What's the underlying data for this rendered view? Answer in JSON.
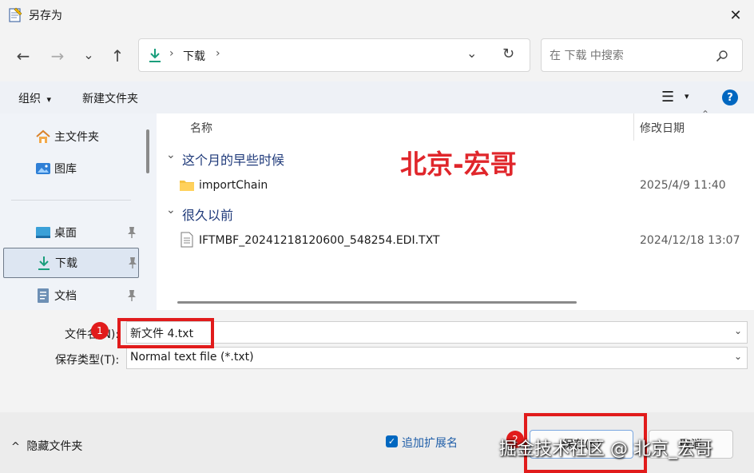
{
  "window": {
    "title": "另存为",
    "close_glyph": "✕"
  },
  "nav": {
    "back_glyph": "←",
    "forward_glyph": "→",
    "recent_glyph": "⌄",
    "up_glyph": "↑",
    "breadcrumb": {
      "sep": "›",
      "current": "下载",
      "sep_end": "›"
    },
    "dropdown_glyph": "⌄",
    "refresh_glyph": "↻"
  },
  "search": {
    "placeholder": "在 下载 中搜索"
  },
  "toolbar": {
    "organize_label": "组织",
    "organize_caret": "▾",
    "new_folder_label": "新建文件夹",
    "view_glyph": "☰",
    "view_caret": "▾",
    "help_glyph": "?"
  },
  "sidebar": {
    "items": [
      {
        "label": "主文件夹",
        "icon": "home-icon"
      },
      {
        "label": "图库",
        "icon": "gallery-icon"
      },
      {
        "label": "桌面",
        "icon": "desktop-icon",
        "pinned": true
      },
      {
        "label": "下载",
        "icon": "download-icon",
        "pinned": true,
        "selected": true
      },
      {
        "label": "文档",
        "icon": "document-icon",
        "pinned": true
      }
    ]
  },
  "file_list": {
    "columns": {
      "name": "名称",
      "modified": "修改日期"
    },
    "groups": [
      {
        "label": "这个月的早些时候",
        "caret": "⌄",
        "rows": [
          {
            "name": "importChain",
            "type": "folder",
            "modified": "2025/4/9 11:40"
          }
        ]
      },
      {
        "label": "很久以前",
        "caret": "⌄",
        "rows": [
          {
            "name": "IFTMBF_20241218120600_548254.EDI.TXT",
            "type": "file",
            "modified": "2024/12/18 13:07"
          }
        ]
      }
    ],
    "watermark": "北京-宏哥"
  },
  "form": {
    "filename_label": "文件名(N):",
    "filename_value": "新文件 4.txt",
    "filetype_label": "保存类型(T):",
    "filetype_value": "Normal text file (*.txt)",
    "dropdown_glyph": "⌄"
  },
  "footer": {
    "hide_folders_label": "隐藏文件夹",
    "hide_caret": "^",
    "append_ext_label": "追加扩展名",
    "append_ext_checked": true,
    "save_label": "保存(S)",
    "cancel_label": "取消",
    "badges": [
      "1",
      "2"
    ],
    "watermark_bottom": "掘金技术社区 @ 北京_宏哥"
  },
  "colors": {
    "accent": "#0067c0",
    "annotation_red": "#e11b1b",
    "watermark_red": "#e0262b"
  }
}
